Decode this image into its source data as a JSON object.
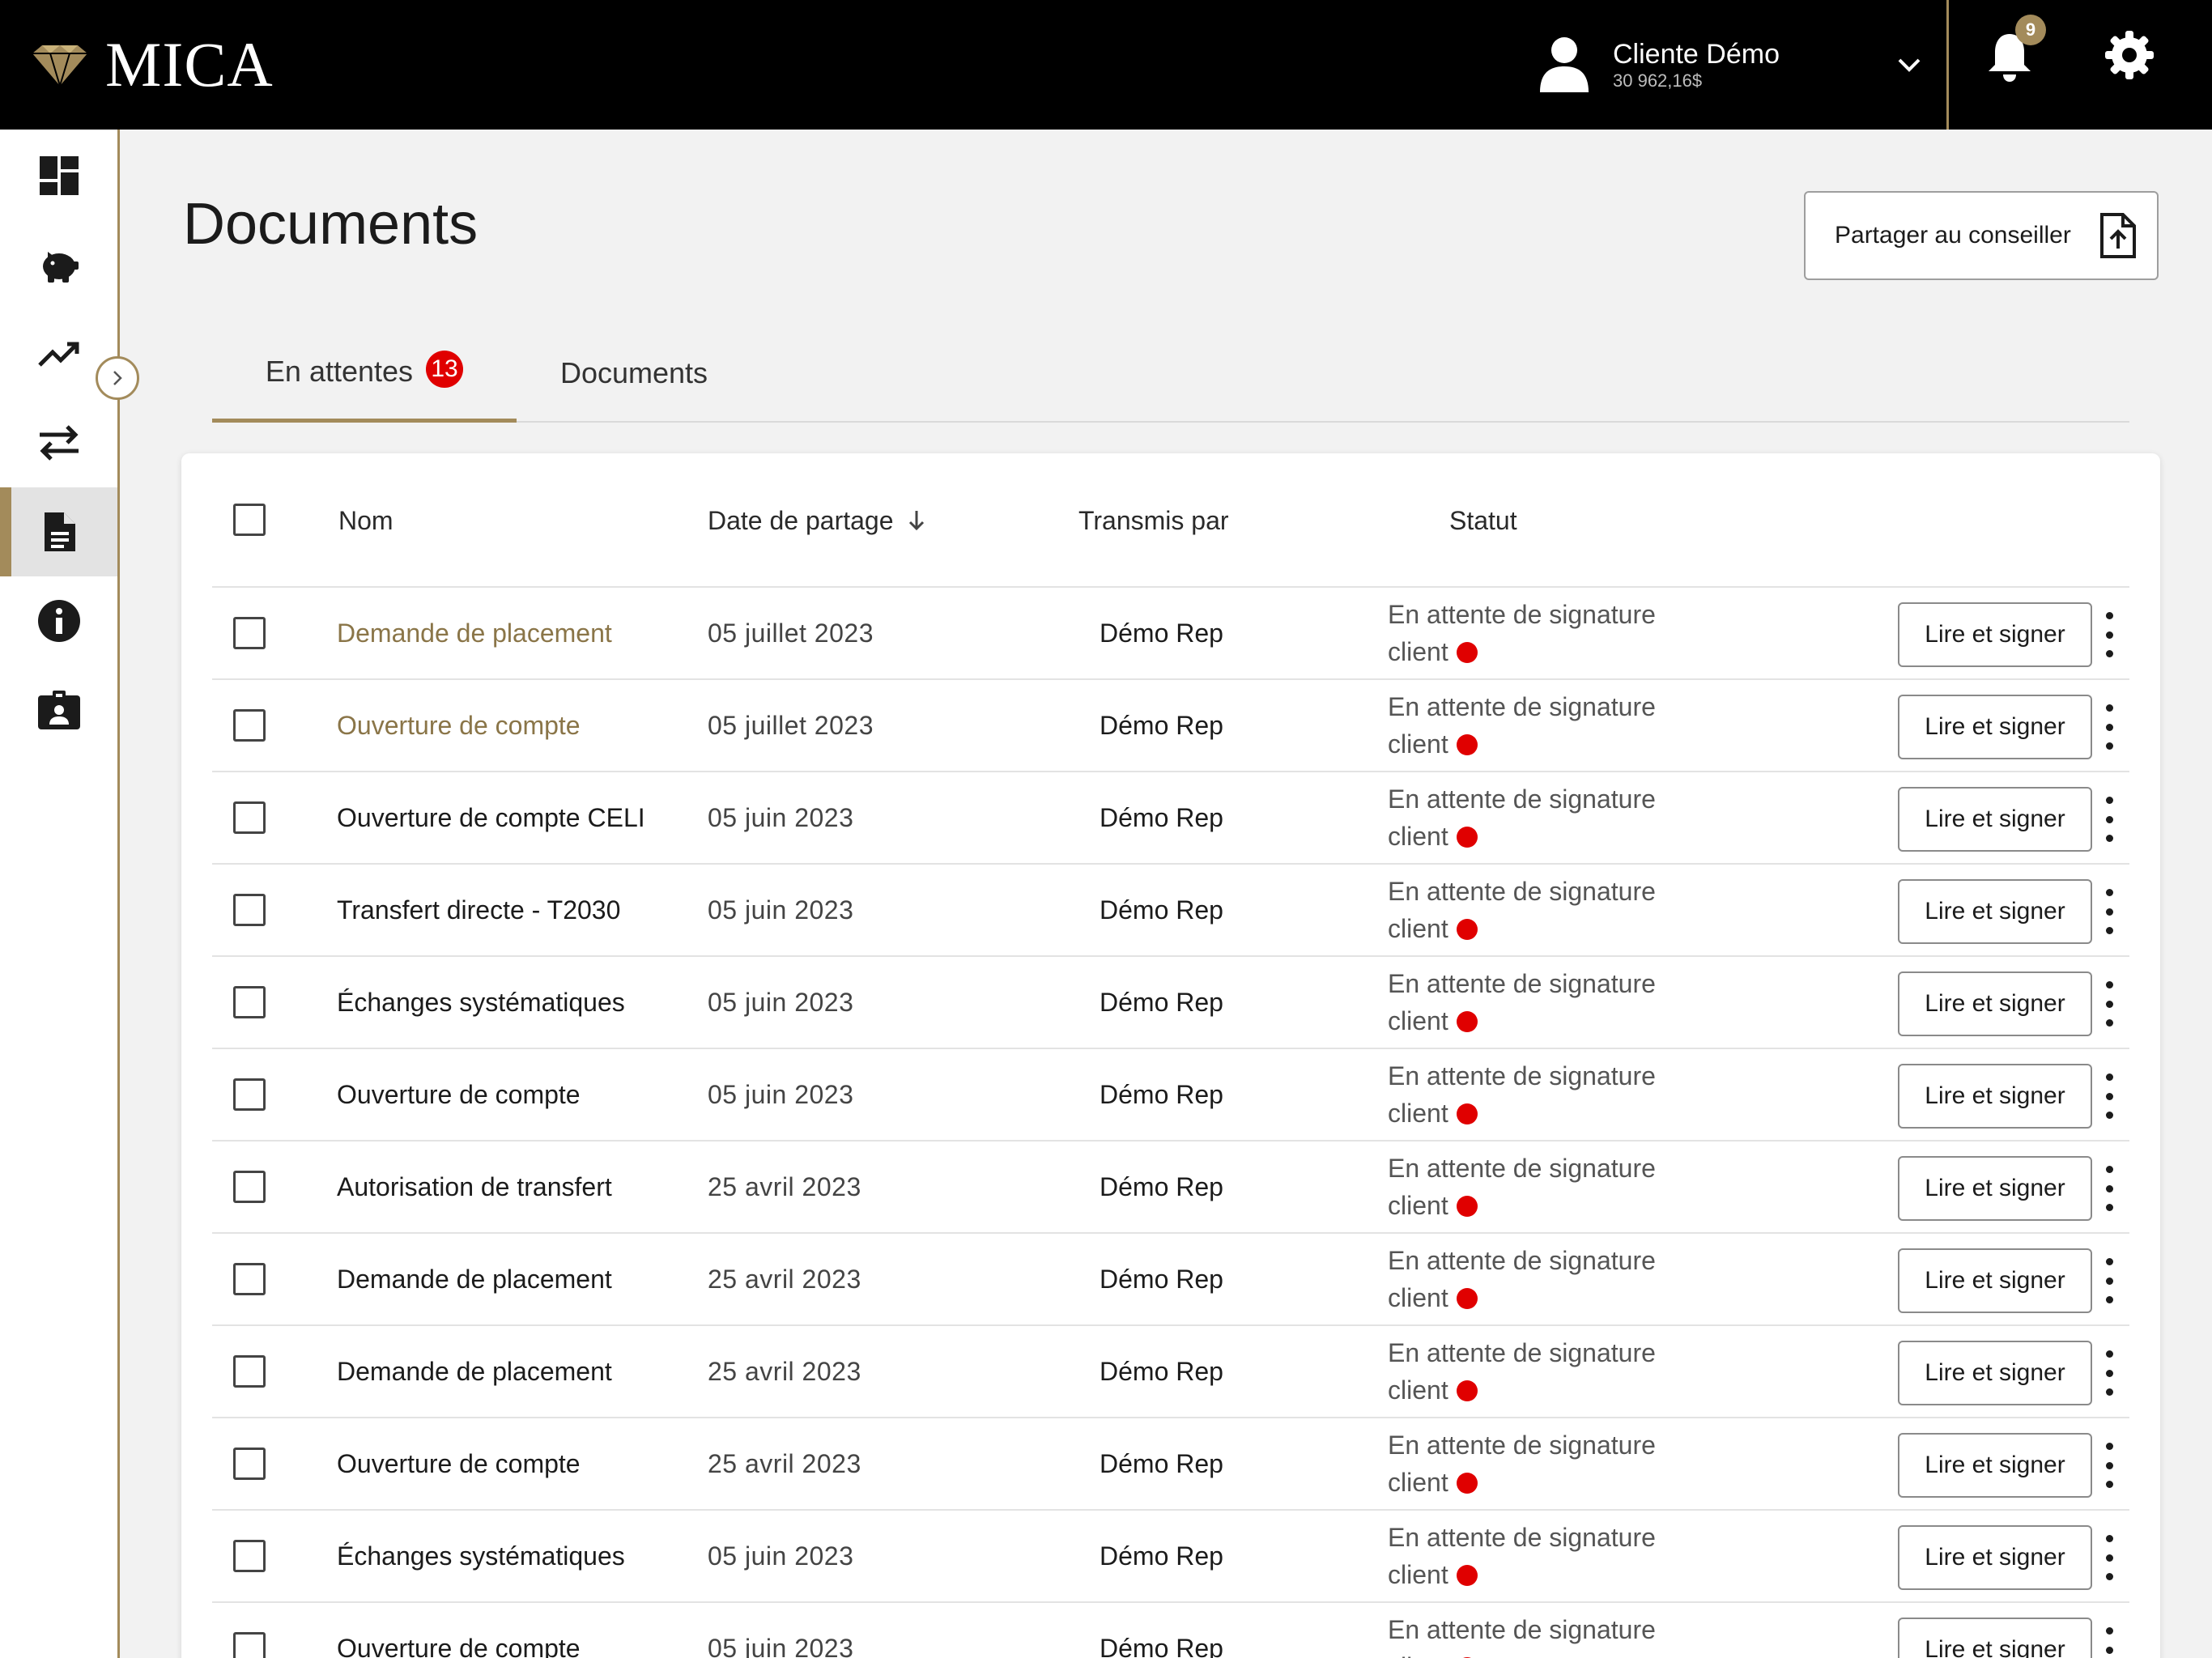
{
  "app": {
    "brand": "MICA"
  },
  "user": {
    "name": "Cliente Démo",
    "balance": "30 962,16$"
  },
  "notifications": {
    "count": "9"
  },
  "sidebar": {
    "items": [
      {
        "name": "dashboard-icon"
      },
      {
        "name": "piggy-bank-icon"
      },
      {
        "name": "trending-up-icon"
      },
      {
        "name": "transfer-arrows-icon"
      },
      {
        "name": "document-icon",
        "active": true
      },
      {
        "name": "info-icon"
      },
      {
        "name": "contact-card-icon"
      }
    ]
  },
  "page": {
    "title": "Documents",
    "share_button": "Partager au conseiller"
  },
  "tabs": [
    {
      "label": "En attentes",
      "badge": "13",
      "active": true
    },
    {
      "label": "Documents",
      "active": false
    }
  ],
  "table": {
    "headers": {
      "name": "Nom",
      "date": "Date de partage",
      "sender": "Transmis par",
      "status": "Statut"
    },
    "rows": [
      {
        "name": "Demande de placement",
        "date": "05 juillet 2023",
        "sender": "Démo Rep",
        "status_line1": "En attente de signature",
        "status_line2": "client",
        "action": "Lire et signer"
      },
      {
        "name": "Ouverture de compte",
        "date": "05 juillet 2023",
        "sender": "Démo Rep",
        "status_line1": "En attente de signature",
        "status_line2": "client",
        "action": "Lire et signer"
      },
      {
        "name": "Ouverture de compte CELI",
        "date": "05 juin 2023",
        "sender": "Démo Rep",
        "status_line1": "En attente de signature",
        "status_line2": "client",
        "action": "Lire et signer"
      },
      {
        "name": "Transfert directe - T2030",
        "date": "05 juin 2023",
        "sender": "Démo Rep",
        "status_line1": "En attente de signature",
        "status_line2": "client",
        "action": "Lire et signer"
      },
      {
        "name": "Échanges systématiques",
        "date": "05 juin 2023",
        "sender": "Démo Rep",
        "status_line1": "En attente de signature",
        "status_line2": "client",
        "action": "Lire et signer"
      },
      {
        "name": "Ouverture de compte",
        "date": "05 juin 2023",
        "sender": "Démo Rep",
        "status_line1": "En attente de signature",
        "status_line2": "client",
        "action": "Lire et signer"
      },
      {
        "name": "Autorisation de transfert",
        "date": "25 avril 2023",
        "sender": "Démo Rep",
        "status_line1": "En attente de signature",
        "status_line2": "client",
        "action": "Lire et signer"
      },
      {
        "name": "Demande de placement",
        "date": "25 avril 2023",
        "sender": "Démo Rep",
        "status_line1": "En attente de signature",
        "status_line2": "client",
        "action": "Lire et signer"
      },
      {
        "name": "Demande de placement",
        "date": "25 avril 2023",
        "sender": "Démo Rep",
        "status_line1": "En attente de signature",
        "status_line2": "client",
        "action": "Lire et signer"
      },
      {
        "name": "Ouverture de compte",
        "date": "25 avril 2023",
        "sender": "Démo Rep",
        "status_line1": "En attente de signature",
        "status_line2": "client",
        "action": "Lire et signer"
      },
      {
        "name": "Échanges systématiques",
        "date": "05 juin 2023",
        "sender": "Démo Rep",
        "status_line1": "En attente de signature",
        "status_line2": "client",
        "action": "Lire et signer"
      },
      {
        "name": "Ouverture de compte",
        "date": "05 juin 2023",
        "sender": "Démo Rep",
        "status_line1": "En attente de signature",
        "status_line2": "client",
        "action": "Lire et signer"
      }
    ]
  },
  "colors": {
    "accent": "#a38b5b",
    "topbar": "#000000",
    "status_dot": "#e00000",
    "badge": "#e00000"
  }
}
